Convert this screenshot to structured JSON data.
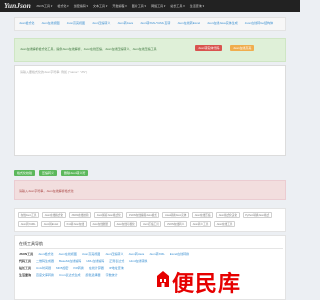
{
  "header": {
    "logo": "YunJson",
    "nav": [
      "JSON工具 ▾",
      "格式化 ▾",
      "加密编码 ▾",
      "文本工具 ▾",
      "开发编程 ▾",
      "图片工具 ▾",
      "网络工具 ▾",
      "站长工具 ▾",
      "生活查询 ▾"
    ]
  },
  "subtabs": [
    "Json格式化",
    "Json在线视图",
    "Json高亮视图",
    "Json压缩转义",
    "Json转Java",
    "Json转XML/YAML互转",
    "Json在线转Excel",
    "Json在线Java实体生成",
    "Json在线转Go结构体"
  ],
  "tip": {
    "text": "Json在线解析格式化工具，提供Json在线解析、Json在线压缩、Json在线压缩转义、Json在线压缩工具",
    "btn_red": "Json转实体代码",
    "btn_orange": "Json在线高亮"
  },
  "editor": {
    "placeholder": "请输入要格式化的Json字符串: 例如 {\"name\": \"ZS\"}"
  },
  "actions": [
    "格式化校验",
    "压缩转义",
    "删除Json转义符"
  ],
  "alert": {
    "text": "请输入Json字符串，Json在线解析格式化"
  },
  "chips": [
    "在线Json工具",
    "Json在线格式化",
    "JSON在线校验",
    "Json解析Json格式化",
    "JSON在线编辑Json格式",
    "Java转换Json实体",
    "Json在线压缩",
    "Json格式化美化",
    "Python转换Json格式",
    "Json转YAML",
    "Json转Excel",
    "Xml转Json在线",
    "Json在线图谱",
    "Json在线可视化",
    "Json压缩工具",
    "JSON在线转义",
    "Json转义工具",
    "Json在线工具"
  ],
  "tools": {
    "title": "在线工具导航",
    "rows": [
      {
        "cat": "JSON工具",
        "links": [
          "Json格式化",
          "Json在线视图",
          "Json高亮视图",
          "Json压缩转义",
          "Json转Java",
          "Json转XML",
          "Excel在线转换"
        ]
      },
      {
        "cat": "代码工具",
        "links": [
          "二维码生成器",
          "Base64在线编码",
          "URL在线编码",
          "正则表达式",
          "Html在线转换"
        ]
      },
      {
        "cat": "站长工具",
        "links": [
          "Unix时间戳",
          "MD5加密",
          "Pdf转换",
          "在线计算器",
          "IP地址查询"
        ]
      },
      {
        "cat": "生活查询",
        "links": [
          "百度文库转换",
          "Cron表达式生成",
          "颜色选择器",
          "字数统计"
        ]
      }
    ]
  },
  "watermark": {
    "text": "便民库",
    "url": "www.bianminku.com"
  }
}
